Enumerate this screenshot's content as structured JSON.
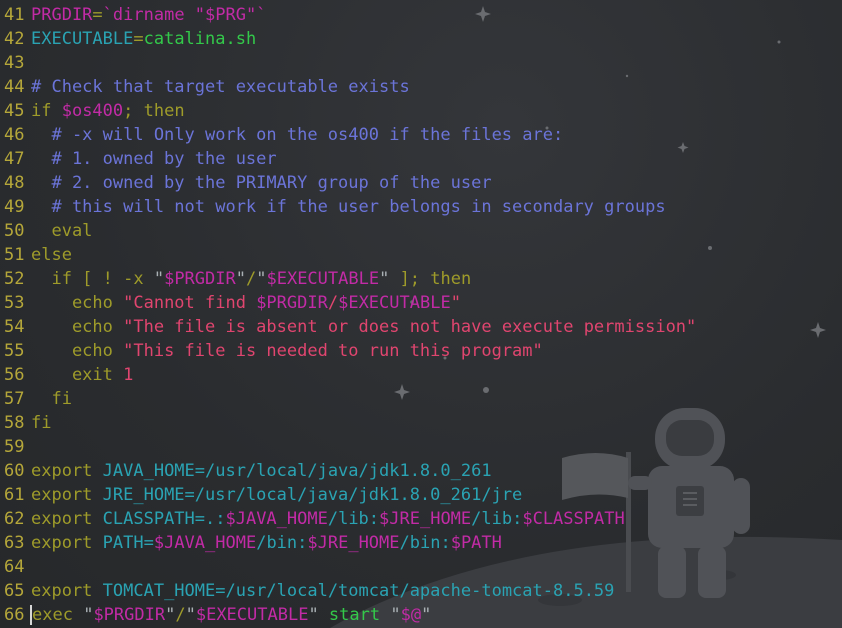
{
  "colors": {
    "background": "#2b2d30",
    "line_number": "#b5a73a",
    "keyword": "#9e9b2a",
    "variable": "#c22ba6",
    "path": "#2aa3b3",
    "value": "#33c94a",
    "comment": "#6b74d8",
    "string": "#e0456f"
  },
  "editor": {
    "background_image": "astronaut-on-moon-with-flag",
    "lines": [
      {
        "n": "41",
        "tokens": [
          [
            "var",
            "PRGDIR"
          ],
          [
            "kw",
            "="
          ],
          [
            "var",
            "`dirname \"$PRG\"`"
          ]
        ]
      },
      {
        "n": "42",
        "tokens": [
          [
            "cyan",
            "EXECUTABLE"
          ],
          [
            "kw",
            "="
          ],
          [
            "grn",
            "catalina.sh"
          ]
        ]
      },
      {
        "n": "43",
        "tokens": []
      },
      {
        "n": "44",
        "tokens": [
          [
            "cmt",
            "# Check that target executable exists"
          ]
        ]
      },
      {
        "n": "45",
        "tokens": [
          [
            "kw",
            "if "
          ],
          [
            "var",
            "$os400"
          ],
          [
            "kw",
            "; then"
          ]
        ]
      },
      {
        "n": "46",
        "tokens": [
          [
            "cmt",
            "  # -x will Only work on the os400 if the files are:"
          ]
        ]
      },
      {
        "n": "47",
        "tokens": [
          [
            "cmt",
            "  # 1. owned by the user"
          ]
        ]
      },
      {
        "n": "48",
        "tokens": [
          [
            "cmt",
            "  # 2. owned by the PRIMARY group of the user"
          ]
        ]
      },
      {
        "n": "49",
        "tokens": [
          [
            "cmt",
            "  # this will not work if the user belongs in secondary groups"
          ]
        ]
      },
      {
        "n": "50",
        "tokens": [
          [
            "kw",
            "  eval"
          ]
        ]
      },
      {
        "n": "51",
        "tokens": [
          [
            "kw",
            "else"
          ]
        ]
      },
      {
        "n": "52",
        "tokens": [
          [
            "kw",
            "  if [ ! -x "
          ],
          [
            "wht",
            "\""
          ],
          [
            "var",
            "$PRGDIR"
          ],
          [
            "wht",
            "\""
          ],
          [
            "kw",
            "/"
          ],
          [
            "wht",
            "\""
          ],
          [
            "var",
            "$EXECUTABLE"
          ],
          [
            "wht",
            "\""
          ],
          [
            "kw",
            " ]; then"
          ]
        ]
      },
      {
        "n": "53",
        "tokens": [
          [
            "kw",
            "    echo "
          ],
          [
            "str",
            "\"Cannot find "
          ],
          [
            "var",
            "$PRGDIR"
          ],
          [
            "str",
            "/"
          ],
          [
            "var",
            "$EXECUTABLE"
          ],
          [
            "str",
            "\""
          ]
        ]
      },
      {
        "n": "54",
        "tokens": [
          [
            "kw",
            "    echo "
          ],
          [
            "str",
            "\"The file is absent or does not have execute permission\""
          ]
        ]
      },
      {
        "n": "55",
        "tokens": [
          [
            "kw",
            "    echo "
          ],
          [
            "str",
            "\"This file is needed to run this program\""
          ]
        ]
      },
      {
        "n": "56",
        "tokens": [
          [
            "kw",
            "    exit "
          ],
          [
            "num",
            "1"
          ]
        ]
      },
      {
        "n": "57",
        "tokens": [
          [
            "kw",
            "  fi"
          ]
        ]
      },
      {
        "n": "58",
        "tokens": [
          [
            "kw",
            "fi"
          ]
        ]
      },
      {
        "n": "59",
        "tokens": []
      },
      {
        "n": "60",
        "tokens": [
          [
            "kw",
            "export "
          ],
          [
            "cyan",
            "JAVA_HOME=/usr/local/java/jdk1.8.0_261"
          ]
        ]
      },
      {
        "n": "61",
        "tokens": [
          [
            "kw",
            "export "
          ],
          [
            "cyan",
            "JRE_HOME=/usr/local/java/jdk1.8.0_261/jre"
          ]
        ]
      },
      {
        "n": "62",
        "tokens": [
          [
            "kw",
            "export "
          ],
          [
            "cyan",
            "CLASSPATH=.:"
          ],
          [
            "var",
            "$JAVA_HOME"
          ],
          [
            "cyan",
            "/lib:"
          ],
          [
            "var",
            "$JRE_HOME"
          ],
          [
            "cyan",
            "/lib:"
          ],
          [
            "var",
            "$CLASSPATH"
          ]
        ]
      },
      {
        "n": "63",
        "tokens": [
          [
            "kw",
            "export "
          ],
          [
            "cyan",
            "PATH="
          ],
          [
            "var",
            "$JAVA_HOME"
          ],
          [
            "cyan",
            "/bin:"
          ],
          [
            "var",
            "$JRE_HOME"
          ],
          [
            "cyan",
            "/bin:"
          ],
          [
            "var",
            "$PATH"
          ]
        ]
      },
      {
        "n": "64",
        "tokens": []
      },
      {
        "n": "65",
        "tokens": [
          [
            "kw",
            "export "
          ],
          [
            "cyan",
            "TOMCAT_HOME=/usr/local/tomcat/apache-tomcat-8.5.59"
          ]
        ]
      },
      {
        "n": "66",
        "tokens": [
          [
            "cursor",
            ""
          ],
          [
            "kw",
            "exec "
          ],
          [
            "wht",
            "\""
          ],
          [
            "var",
            "$PRGDIR"
          ],
          [
            "wht",
            "\""
          ],
          [
            "kw",
            "/"
          ],
          [
            "wht",
            "\""
          ],
          [
            "var",
            "$EXECUTABLE"
          ],
          [
            "wht",
            "\""
          ],
          [
            "grn",
            " start "
          ],
          [
            "wht",
            "\""
          ],
          [
            "var",
            "$@"
          ],
          [
            "wht",
            "\""
          ]
        ]
      }
    ]
  }
}
